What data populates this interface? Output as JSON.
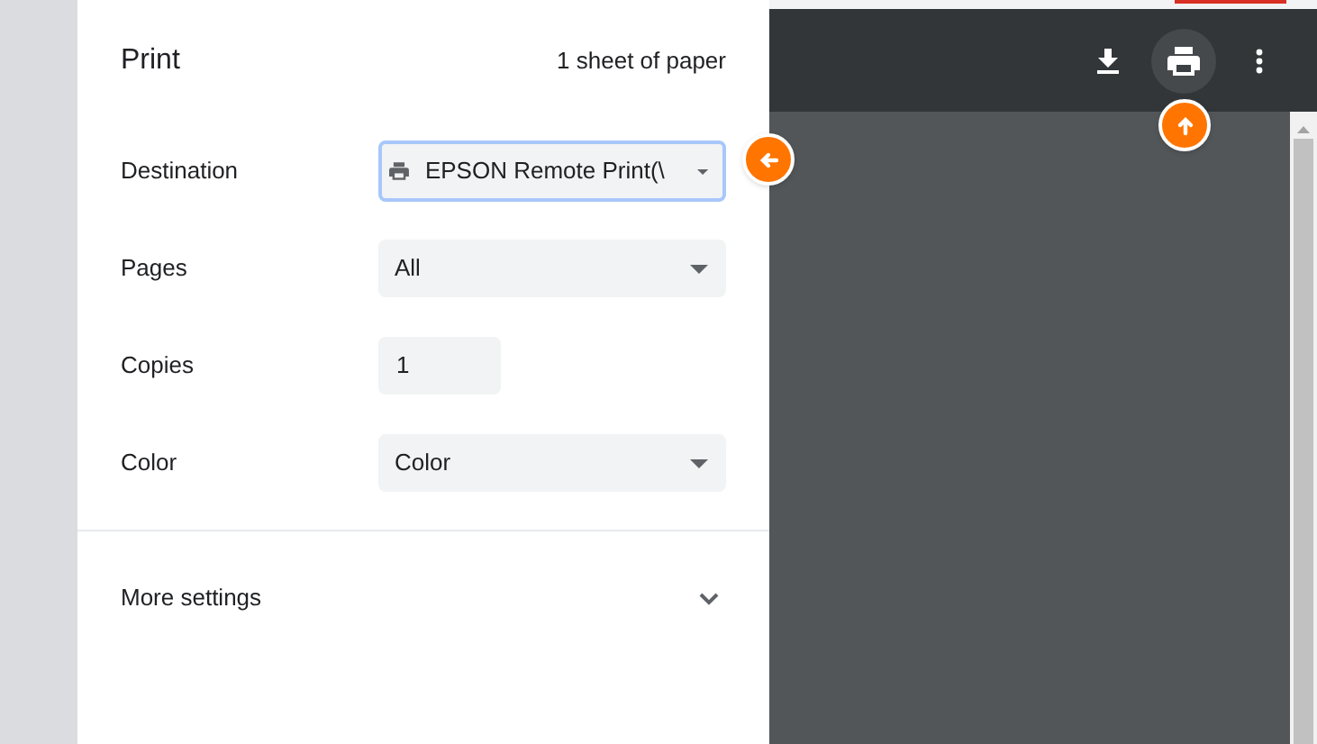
{
  "print_panel": {
    "title": "Print",
    "sheet_count": "1 sheet of paper",
    "settings": [
      {
        "label": "Destination",
        "kind": "device-select",
        "value": "EPSON Remote Print(\\",
        "focused": true
      },
      {
        "label": "Pages",
        "kind": "select",
        "value": "All",
        "focused": false
      },
      {
        "label": "Copies",
        "kind": "number",
        "value": "1",
        "focused": false
      },
      {
        "label": "Color",
        "kind": "select",
        "value": "Color",
        "focused": false
      }
    ],
    "more_settings": {
      "label": "More settings",
      "expanded": false
    }
  },
  "toolbar": {
    "buttons": [
      {
        "kind": "download",
        "selected": false
      },
      {
        "kind": "print",
        "selected": true
      },
      {
        "kind": "more",
        "selected": false
      }
    ]
  },
  "callouts": [
    {
      "kind": "left"
    },
    {
      "kind": "up"
    }
  ]
}
